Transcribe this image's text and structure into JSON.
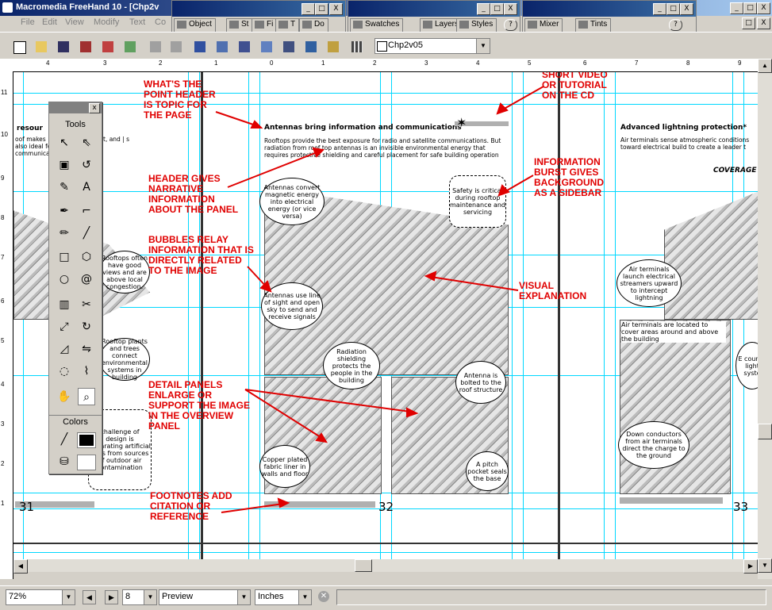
{
  "window": {
    "title": "Macromedia FreeHand 10 - [Chp2v",
    "minimize": "_",
    "maximize": "□",
    "close": "X"
  },
  "menus": [
    "File",
    "Edit",
    "View",
    "Modify",
    "Text",
    "Co"
  ],
  "panels": {
    "object_tabs": [
      "Object",
      "St",
      "Fi",
      "T",
      "Do"
    ],
    "swatches_tabs": [
      "Swatches",
      "Layers",
      "Styles"
    ],
    "mixer_tabs": [
      "Mixer",
      "Tints"
    ],
    "help": "?"
  },
  "toolbar": {
    "document_select": "Chp2v05"
  },
  "rulers": {
    "top": [
      "4",
      "3",
      "2",
      "1",
      "0",
      "1",
      "2",
      "3",
      "4",
      "5",
      "6",
      "7",
      "8",
      "9"
    ],
    "left": [
      "11",
      "10",
      "9",
      "8",
      "7",
      "6",
      "5",
      "4",
      "3",
      "2",
      "1"
    ]
  },
  "tools_palette": {
    "title": "Tools",
    "colors_title": "Colors",
    "close": "x"
  },
  "page31": {
    "header": "resour",
    "body": "oof makes | source fo | unlight, and | s also ideal fo | ell as radi | communications",
    "bubble1": "Rooftops often have good views and are above local congestion.",
    "bubble2": "Rooftop plants and trees connect environmental systems in building",
    "bubble3": "challenge of design is separating artificial uses from sources of outdoor air contamination",
    "page_number": "31"
  },
  "page32": {
    "header": "Antennas bring information and communications",
    "body": "Rooftops provide the best exposure for radio and satellite communications. But radiation from roof top antennas is an invisible environmental energy that requires protective shielding and careful placement for safe building operation",
    "bubble_energy": "Antennas convert magnetic energy into electrical energy (or vice versa)",
    "burst_safety": "Safety is critical during rooftop maintenance and servicing",
    "bubble_los": "Antennas use line of sight and open sky to send and receive signals",
    "bubble_radiation": "Radiation shielding protects the people in the building",
    "bubble_bolted": "Antenna is bolted to the roof structure",
    "bubble_copper": "Copper plated fabric liner in walls and floor",
    "bubble_pitch": "A pitch pocket seals the base",
    "page_number": "32"
  },
  "page33": {
    "header": "Advanced lightning protection*",
    "body": "Air terminals sense atmospheric conditions toward electrical build to create a leader t",
    "coverage": "COVERAGE",
    "bubble_launch": "Air terminals launch electrical streamers upward to intercept lightning",
    "caption": "Air terminals are located to cover areas around and above the building",
    "bubble_down": "Down conductors from air terminals direct the charge to the ground",
    "bubble_edge": "E counte light syste",
    "page_number": "33"
  },
  "annotations": [
    "WHAT'S THE\nPOINT HEADER\nIS TOPIC FOR\nTHE PAGE",
    "HEADER GIVES\nNARRATIVE\nINFORMATION\nABOUT THE PANEL",
    "BUBBLES RELAY\nINFORMATION THAT IS\nDIRECTLY RELATED\nTO THE IMAGE",
    "DETAIL PANELS\nENLARGE OR\nSUPPORT THE IMAGE\nIN THE OVERVIEW\nPANEL",
    "FOOTNOTES ADD\nCITATION OR\nREFERENCE",
    "SHORT VIDEO\nOR TUTORIAL\nON THE CD",
    "INFORMATION\nBURST GIVES\nBACKGROUND\nAS A SIDEBAR",
    "VISUAL\nEXPLANATION"
  ],
  "statusbar": {
    "zoom": "72%",
    "page": "8",
    "view_mode": "Preview",
    "units": "Inches"
  },
  "colors": {
    "annotation_red": "#e00000",
    "guide_cyan": "#00d8ff",
    "titlebar_blue": "#0a246a"
  }
}
